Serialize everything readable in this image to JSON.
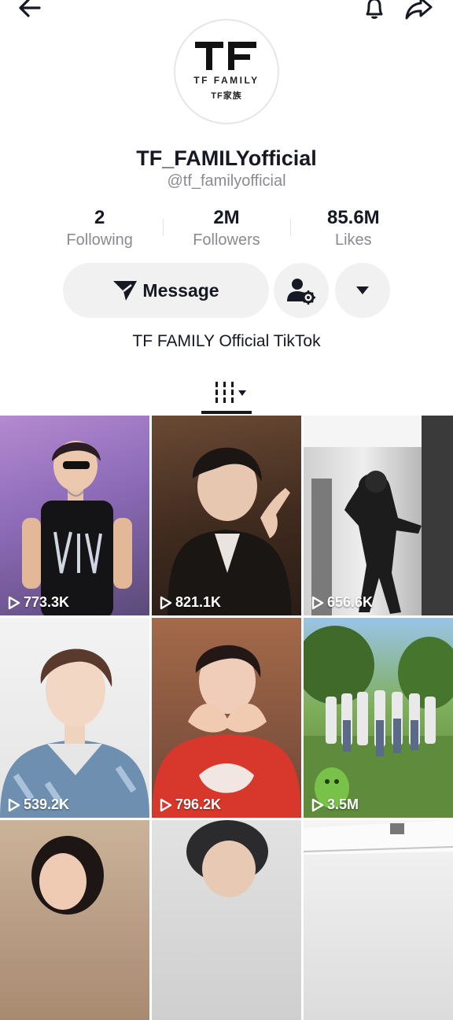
{
  "profile": {
    "logo_brand": "TF FAMILY",
    "logo_brand_cn": "TF家族",
    "display_name": "TF_FAMILYofficial",
    "handle": "@tf_familyofficial",
    "bio": "TF FAMILY Official TikTok"
  },
  "stats": [
    {
      "value": "2",
      "label": "Following"
    },
    {
      "value": "2M",
      "label": "Followers"
    },
    {
      "value": "85.6M",
      "label": "Likes"
    }
  ],
  "actions": {
    "message_label": "Message"
  },
  "icons": {
    "back": "arrow-left-icon",
    "bell": "bell-icon",
    "share": "share-icon",
    "send": "send-icon",
    "person": "person-settings-icon",
    "more": "caret-down-icon",
    "tab": "video-grid-icon",
    "play": "play-icon"
  },
  "colors": {
    "text_primary": "#161823",
    "text_secondary": "#8a8b91",
    "button_bg": "#f1f1f2"
  },
  "videos": [
    {
      "views": "773.3K"
    },
    {
      "views": "821.1K"
    },
    {
      "views": "656.6K"
    },
    {
      "views": "539.2K"
    },
    {
      "views": "796.2K"
    },
    {
      "views": "3.5M"
    },
    {
      "views": ""
    },
    {
      "views": ""
    },
    {
      "views": ""
    }
  ]
}
